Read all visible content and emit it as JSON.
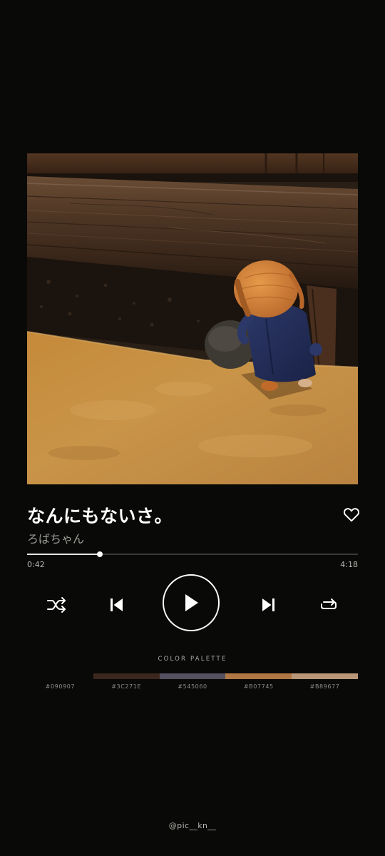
{
  "track": {
    "title": "なんにもないさ。",
    "artist": "ろばちゃん",
    "liked": false,
    "progress_fraction": 0.22
  },
  "player": {
    "elapsed": "0:42",
    "total": "4:18",
    "controls": [
      "shuffle-icon",
      "skip-previous-icon",
      "play-icon",
      "skip-next-icon",
      "repeat-icon"
    ]
  },
  "palette": {
    "heading": "COLOR PALETTE",
    "colors": [
      {
        "hex": "#090907",
        "label": "#090907"
      },
      {
        "hex": "#3C271E",
        "label": "#3C271E"
      },
      {
        "hex": "#545060",
        "label": "#545060"
      },
      {
        "hex": "#B07745",
        "label": "#B07745"
      },
      {
        "hex": "#B89677",
        "label": "#B89677"
      }
    ]
  },
  "footer": {
    "credit": "@pic__kn__"
  },
  "theme": {
    "background": "#090907",
    "text": "#ffffff",
    "muted": "#9a9a96"
  }
}
